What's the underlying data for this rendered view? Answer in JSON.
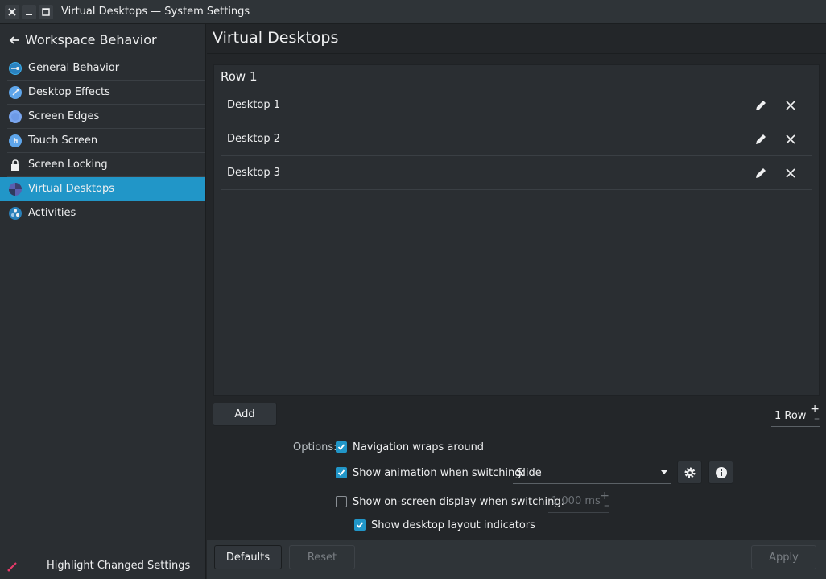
{
  "window": {
    "title": "Virtual Desktops — System Settings"
  },
  "sidebar": {
    "header": "Workspace Behavior",
    "items": [
      {
        "label": "General Behavior",
        "icon": "general-behavior-icon",
        "color": "#3daee9"
      },
      {
        "label": "Desktop Effects",
        "icon": "desktop-effects-icon",
        "color": "#3daee9"
      },
      {
        "label": "Screen Edges",
        "icon": "screen-edges-icon",
        "color": "#5e9cf0"
      },
      {
        "label": "Touch Screen",
        "icon": "touch-screen-icon",
        "color": "#3daee9"
      },
      {
        "label": "Screen Locking",
        "icon": "lock-icon",
        "color": "#eff0f1"
      },
      {
        "label": "Virtual Desktops",
        "icon": "virtual-desktops-icon",
        "color": "#5a5fb0",
        "active": true
      },
      {
        "label": "Activities",
        "icon": "activities-icon",
        "color": "#2980b9"
      }
    ],
    "footer": "Highlight Changed Settings"
  },
  "main": {
    "title": "Virtual Desktops",
    "row_label": "Row 1",
    "desktops": [
      "Desktop 1",
      "Desktop 2",
      "Desktop 3"
    ],
    "add_label": "Add",
    "rows_value": "1 Row",
    "options_label": "Options:",
    "options": {
      "nav_wraps": {
        "label": "Navigation wraps around",
        "checked": true
      },
      "show_animation": {
        "label": "Show animation when switching:",
        "checked": true
      },
      "animation_value": "Slide",
      "show_osd": {
        "label": "Show on-screen display when switching:",
        "checked": false
      },
      "osd_duration": "1,000 ms",
      "layout_indicators": {
        "label": "Show desktop layout indicators",
        "checked": true
      }
    }
  },
  "buttons": {
    "defaults": "Defaults",
    "reset": "Reset",
    "apply": "Apply"
  },
  "colors": {
    "accent": "#2196c8",
    "background": "#232629",
    "highlight_icon": "#e93a6a"
  }
}
